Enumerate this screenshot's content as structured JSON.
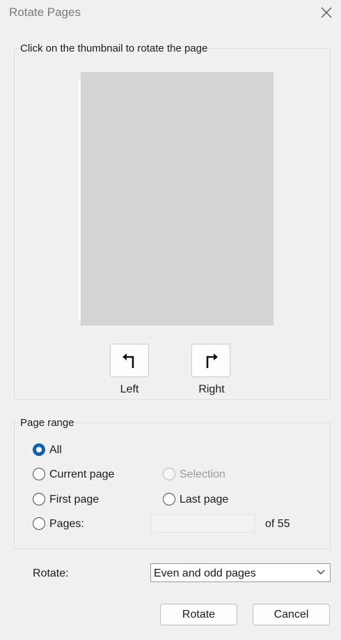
{
  "window": {
    "title": "Rotate Pages"
  },
  "thumbnail_group": {
    "caption": "Click on the thumbnail to rotate the page",
    "left_label": "Left",
    "right_label": "Right"
  },
  "page_range": {
    "caption": "Page range",
    "options": {
      "all": "All",
      "current_page": "Current page",
      "selection": "Selection",
      "first_page": "First page",
      "last_page": "Last page",
      "pages": "Pages:"
    },
    "selected": "all",
    "pages_value": "",
    "of_text": "of 55"
  },
  "rotate": {
    "label": "Rotate:",
    "selected_option": "Even and odd pages"
  },
  "buttons": {
    "rotate": "Rotate",
    "cancel": "Cancel"
  },
  "colors": {
    "accent": "#0f5fb5",
    "thumbnail": "#d4d4d4",
    "background": "#f0f0f0"
  },
  "icons": [
    "close-icon",
    "rotate-left-icon",
    "rotate-right-icon",
    "chevron-down-icon"
  ]
}
